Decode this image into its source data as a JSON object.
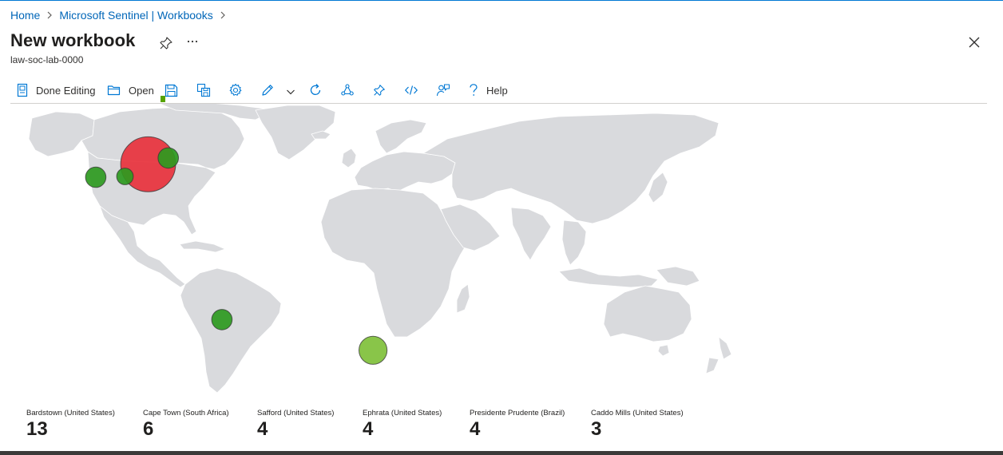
{
  "breadcrumb": [
    {
      "label": "Home"
    },
    {
      "label": "Microsoft Sentinel | Workbooks"
    }
  ],
  "page": {
    "title": "New workbook",
    "subtitle": "law-soc-lab-0000"
  },
  "toolbar": {
    "done_editing_label": "Done Editing",
    "open_label": "Open",
    "help_label": "Help"
  },
  "icons": {
    "pin": "pin-icon",
    "more": "more-icon",
    "close": "close-icon",
    "done_editing": "done-editing-icon",
    "open": "folder-open-icon",
    "save": "save-icon",
    "save_as": "save-as-icon",
    "settings": "gear-icon",
    "edit": "pencil-icon",
    "dropdown": "chevron-down-icon",
    "refresh": "refresh-icon",
    "share": "share-icon",
    "pin_toolbar": "pin-icon",
    "advanced_editor": "code-icon",
    "feedback": "feedback-icon",
    "help": "help-icon"
  },
  "colors": {
    "accent": "#0078d4",
    "link": "#0066b8",
    "land": "#d9dadd",
    "bubble_high": "#e8323c",
    "bubble_mid": "#2e9a1f",
    "bubble_low": "#7fc03a"
  },
  "map": {
    "bubbles": [
      {
        "location": "Bardstown (United States)",
        "count": 13,
        "lon": -85.5,
        "lat": 37.8,
        "color": "#e8323c"
      },
      {
        "location": "Caddo Mills (United States)",
        "count": 3,
        "lon": -96.2,
        "lat": 33.1,
        "color": "#2e9a1f"
      },
      {
        "location": "Safford (United States)",
        "count": 4,
        "lon": -109.7,
        "lat": 32.8,
        "color": "#2e9a1f"
      },
      {
        "location": "Ephrata (United States)",
        "count": 4,
        "lon": -76.2,
        "lat": 40.2,
        "color": "#2e9a1f"
      },
      {
        "location": "Presidente Prudente (Brazil)",
        "count": 4,
        "lon": -51.4,
        "lat": -22.1,
        "color": "#2e9a1f"
      },
      {
        "location": "Cape Town (South Africa)",
        "count": 6,
        "lon": 18.4,
        "lat": -33.9,
        "color": "#7fc03a"
      }
    ]
  },
  "tiles": [
    {
      "label": "Bardstown (United States)",
      "value": "13"
    },
    {
      "label": "Cape Town (South Africa)",
      "value": "6"
    },
    {
      "label": "Safford (United States)",
      "value": "4"
    },
    {
      "label": "Ephrata (United States)",
      "value": "4"
    },
    {
      "label": "Presidente Prudente (Brazil)",
      "value": "4"
    },
    {
      "label": "Caddo Mills (United States)",
      "value": "3"
    }
  ]
}
